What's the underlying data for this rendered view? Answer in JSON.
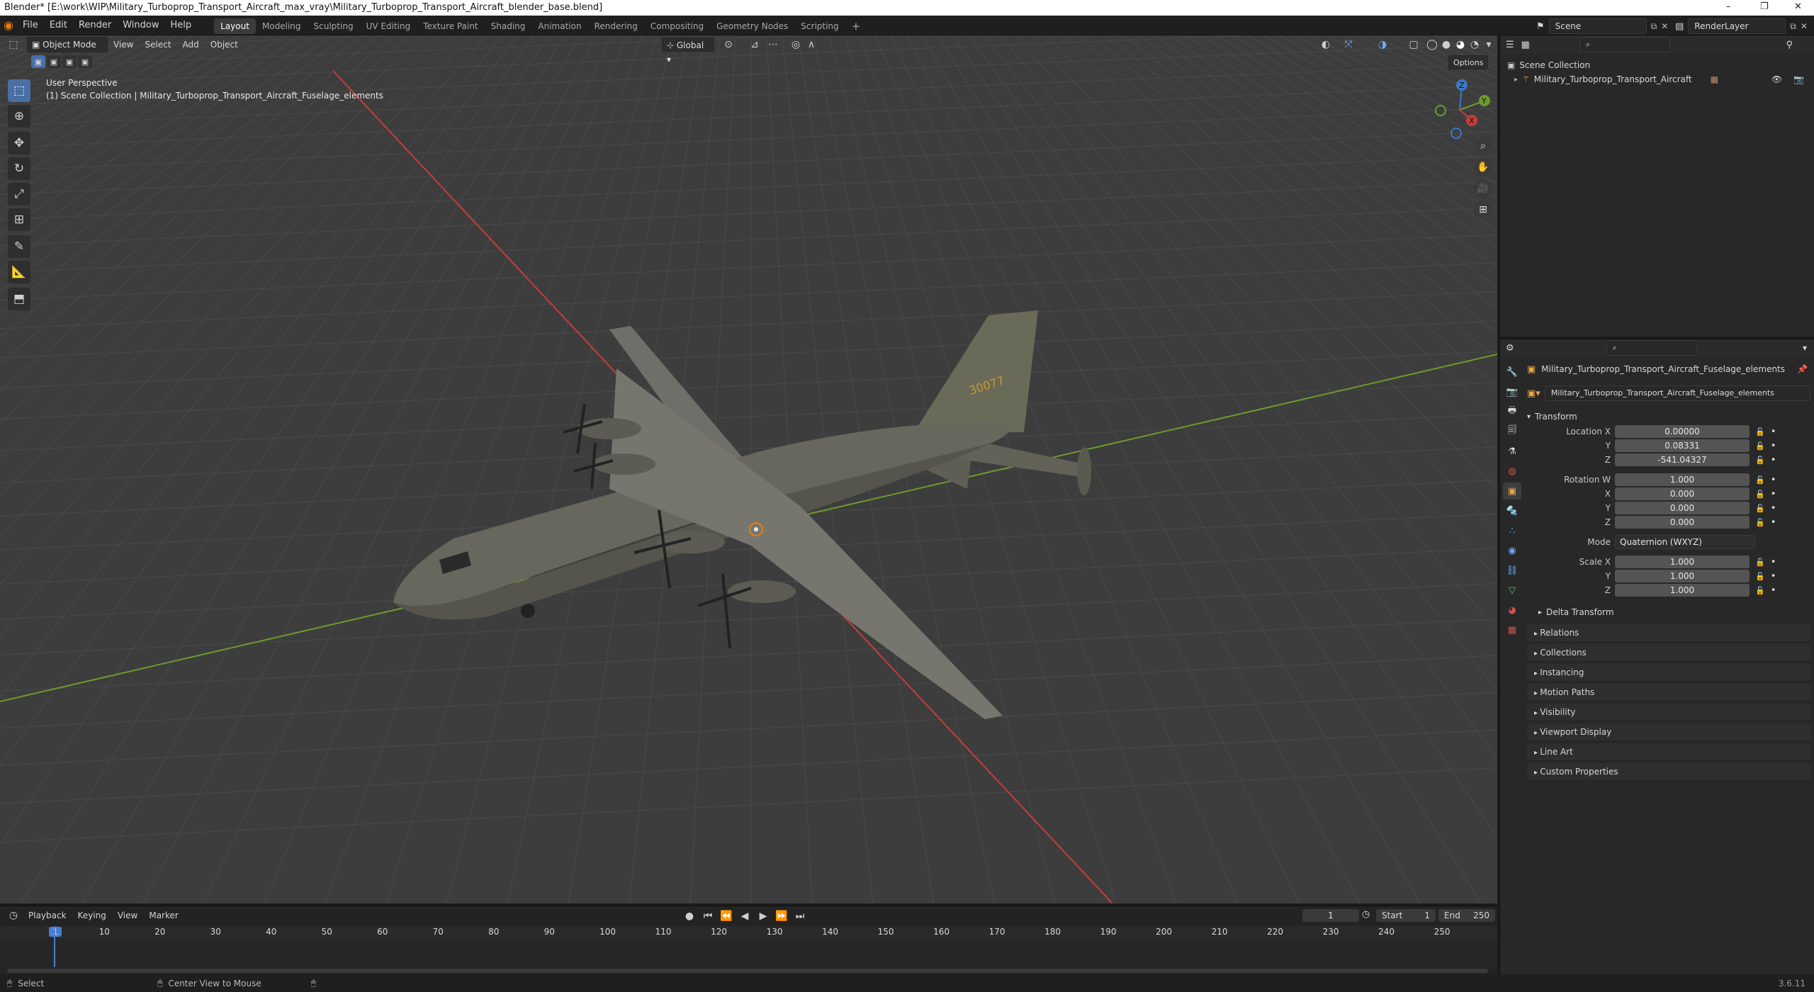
{
  "window": {
    "title": "Blender* [E:\\work\\WIP\\Military_Turboprop_Transport_Aircraft_max_vray\\Military_Turboprop_Transport_Aircraft_blender_base.blend]",
    "controls": [
      "–",
      "❐",
      "✕"
    ]
  },
  "menu": [
    "File",
    "Edit",
    "Render",
    "Window",
    "Help"
  ],
  "workspaces": [
    "Layout",
    "Modeling",
    "Sculpting",
    "UV Editing",
    "Texture Paint",
    "Shading",
    "Animation",
    "Rendering",
    "Compositing",
    "Geometry Nodes",
    "Scripting"
  ],
  "active_workspace": "Layout",
  "topbar": {
    "scene": "Scene",
    "view_layer": "RenderLayer"
  },
  "viewport": {
    "mode": "Object Mode",
    "menus": [
      "View",
      "Select",
      "Add",
      "Object"
    ],
    "transform_orientation": "Global",
    "options_label": "Options",
    "info_line1": "User Perspective",
    "info_line2": "(1) Scene Collection | Military_Turboprop_Transport_Aircraft_Fuselage_elements",
    "tail_number": "30077",
    "gizmo_axes": [
      "X",
      "Y",
      "Z"
    ],
    "colors": {
      "x_axis": "#c83c3c",
      "y_axis": "#6e9a2c",
      "grid": "#4a4a4a",
      "background": "#3d3d3d",
      "accent": "#4a6fa5"
    }
  },
  "outliner": {
    "root": "Scene Collection",
    "items": [
      {
        "name": "Military_Turboprop_Transport_Aircraft"
      }
    ]
  },
  "properties": {
    "object_name": "Military_Turboprop_Transport_Aircraft_Fuselage_elements",
    "data_name": "Military_Turboprop_Transport_Aircraft_Fuselage_elements",
    "transform": {
      "title": "Transform",
      "location": {
        "label": "Location X",
        "x": "0.00000",
        "y": "0.08331",
        "z": "-541.04327"
      },
      "rotation": {
        "label": "Rotation W",
        "w": "1.000",
        "x": "0.000",
        "y": "0.000",
        "z": "0.000"
      },
      "mode_label": "Mode",
      "mode_value": "Quaternion (WXYZ)",
      "scale": {
        "label": "Scale X",
        "x": "1.000",
        "y": "1.000",
        "z": "1.000"
      },
      "axis_labels": {
        "x": "X",
        "y": "Y",
        "z": "Z"
      }
    },
    "subpanels": [
      "Delta Transform"
    ],
    "panels": [
      "Relations",
      "Collections",
      "Instancing",
      "Motion Paths",
      "Visibility",
      "Viewport Display",
      "Line Art",
      "Custom Properties"
    ]
  },
  "timeline": {
    "menus": [
      "Playback",
      "Keying",
      "View",
      "Marker"
    ],
    "current_frame": "1",
    "start_label": "Start",
    "start": "1",
    "end_label": "End",
    "end": "250",
    "ticks": [
      "1",
      "10",
      "20",
      "30",
      "40",
      "50",
      "60",
      "70",
      "80",
      "90",
      "100",
      "110",
      "120",
      "130",
      "140",
      "150",
      "160",
      "170",
      "180",
      "190",
      "200",
      "210",
      "220",
      "230",
      "240",
      "250"
    ]
  },
  "statusbar": {
    "select": "Select",
    "center": "Center View to Mouse",
    "version": "3.6.11"
  }
}
